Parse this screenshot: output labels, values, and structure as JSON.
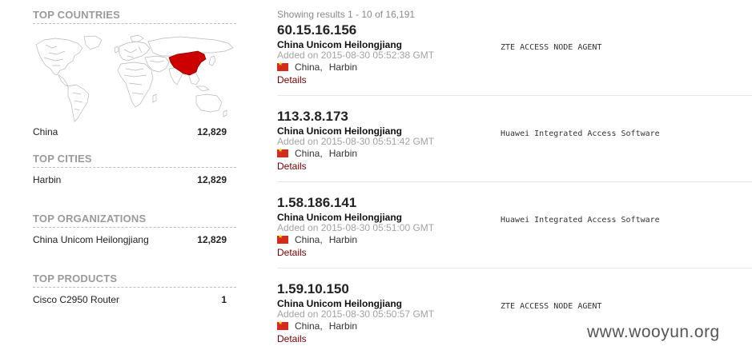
{
  "sidebar": {
    "top_countries": {
      "title": "TOP COUNTRIES",
      "items": [
        {
          "label": "China",
          "value": "12,829"
        }
      ]
    },
    "top_cities": {
      "title": "TOP CITIES",
      "items": [
        {
          "label": "Harbin",
          "value": "12,829"
        }
      ]
    },
    "top_organizations": {
      "title": "TOP ORGANIZATIONS",
      "items": [
        {
          "label": "China Unicom Heilongjiang",
          "value": "12,829"
        }
      ]
    },
    "top_products": {
      "title": "TOP PRODUCTS",
      "items": [
        {
          "label": "Cisco C2950 Router",
          "value": "1"
        }
      ]
    },
    "map": {
      "highlight_color": "#cc0000",
      "land_color": "#ffffff",
      "border_color": "#b5b5b5"
    }
  },
  "results": {
    "summary": "Showing results 1 - 10 of 16,191",
    "items": [
      {
        "ip": "60.15.16.156",
        "org": "China Unicom Heilongjiang",
        "added": "Added on 2015-08-30 05:52:38 GMT",
        "country": "China",
        "sep": ",",
        "city": "Harbin",
        "details": "Details",
        "banner": "ZTE ACCESS NODE AGENT"
      },
      {
        "ip": "113.3.8.173",
        "org": "China Unicom Heilongjiang",
        "added": "Added on 2015-08-30 05:51:42 GMT",
        "country": "China",
        "sep": ",",
        "city": "Harbin",
        "details": "Details",
        "banner": "Huawei Integrated Access Software"
      },
      {
        "ip": "1.58.186.141",
        "org": "China Unicom Heilongjiang",
        "added": "Added on 2015-08-30 05:51:00 GMT",
        "country": "China",
        "sep": ",",
        "city": "Harbin",
        "details": "Details",
        "banner": "Huawei Integrated Access Software"
      },
      {
        "ip": "1.59.10.150",
        "org": "China Unicom Heilongjiang",
        "added": "Added on 2015-08-30 05:50:57 GMT",
        "country": "China",
        "sep": ",",
        "city": "Harbin",
        "details": "Details",
        "banner": "ZTE ACCESS NODE AGENT"
      }
    ]
  },
  "watermark": "www.wooyun.org",
  "colors": {
    "details_link": "#7a0000",
    "muted": "#a3a3a3",
    "section_title": "#9a9a9a"
  }
}
